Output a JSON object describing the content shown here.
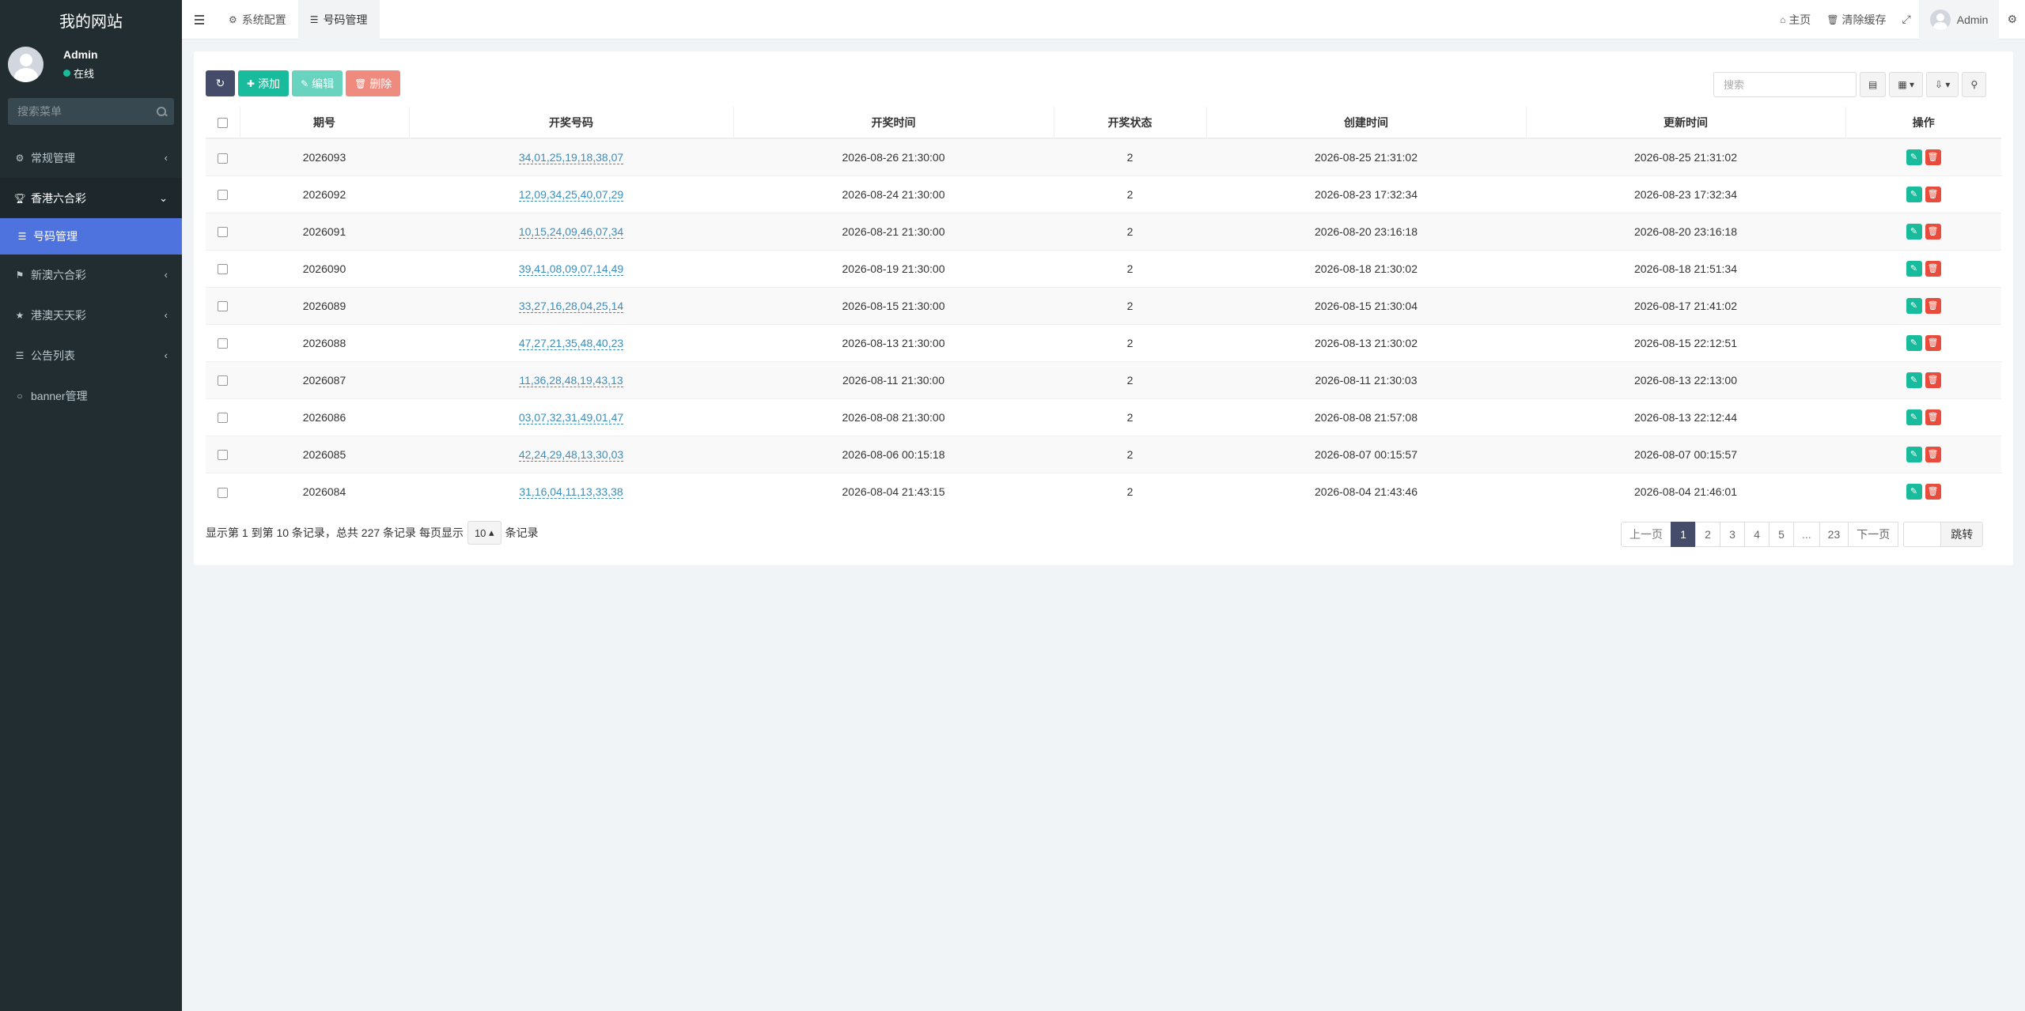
{
  "sidebar": {
    "logo": "我的网站",
    "user": {
      "name": "Admin",
      "status": "在线"
    },
    "search_placeholder": "搜索菜单",
    "items": [
      {
        "label": "常规管理",
        "icon": "cogs-icon"
      },
      {
        "label": "香港六合彩",
        "icon": "trophy-icon"
      },
      {
        "label": "号码管理",
        "icon": "list-icon"
      },
      {
        "label": "新澳六合彩",
        "icon": "flag-icon"
      },
      {
        "label": "港澳天天彩",
        "icon": "star-icon"
      },
      {
        "label": "公告列表",
        "icon": "list-icon"
      },
      {
        "label": "banner管理",
        "icon": "circle-icon"
      }
    ]
  },
  "header": {
    "tabs": [
      {
        "label": "系统配置"
      },
      {
        "label": "号码管理"
      }
    ],
    "right": {
      "home": "主页",
      "clear_cache": "清除缓存",
      "user": "Admin"
    }
  },
  "toolbar": {
    "add": "添加",
    "edit": "编辑",
    "delete": "删除",
    "search_placeholder": "搜索"
  },
  "table": {
    "columns": [
      "期号",
      "开奖号码",
      "开奖时间",
      "开奖状态",
      "创建时间",
      "更新时间",
      "操作"
    ],
    "rows": [
      {
        "issue": "2026093",
        "numbers": "34,01,25,19,18,38,07",
        "draw_time": "2026-08-26 21:30:00",
        "status": "2",
        "created": "2026-08-25 21:31:02",
        "updated": "2026-08-25 21:31:02"
      },
      {
        "issue": "2026092",
        "numbers": "12,09,34,25,40,07,29",
        "draw_time": "2026-08-24 21:30:00",
        "status": "2",
        "created": "2026-08-23 17:32:34",
        "updated": "2026-08-23 17:32:34"
      },
      {
        "issue": "2026091",
        "numbers": "10,15,24,09,46,07,34",
        "draw_time": "2026-08-21 21:30:00",
        "status": "2",
        "created": "2026-08-20 23:16:18",
        "updated": "2026-08-20 23:16:18"
      },
      {
        "issue": "2026090",
        "numbers": "39,41,08,09,07,14,49",
        "draw_time": "2026-08-19 21:30:00",
        "status": "2",
        "created": "2026-08-18 21:30:02",
        "updated": "2026-08-18 21:51:34"
      },
      {
        "issue": "2026089",
        "numbers": "33,27,16,28,04,25,14",
        "draw_time": "2026-08-15 21:30:00",
        "status": "2",
        "created": "2026-08-15 21:30:04",
        "updated": "2026-08-17 21:41:02"
      },
      {
        "issue": "2026088",
        "numbers": "47,27,21,35,48,40,23",
        "draw_time": "2026-08-13 21:30:00",
        "status": "2",
        "created": "2026-08-13 21:30:02",
        "updated": "2026-08-15 22:12:51"
      },
      {
        "issue": "2026087",
        "numbers": "11,36,28,48,19,43,13",
        "draw_time": "2026-08-11 21:30:00",
        "status": "2",
        "created": "2026-08-11 21:30:03",
        "updated": "2026-08-13 22:13:00"
      },
      {
        "issue": "2026086",
        "numbers": "03,07,32,31,49,01,47",
        "draw_time": "2026-08-08 21:30:00",
        "status": "2",
        "created": "2026-08-08 21:57:08",
        "updated": "2026-08-13 22:12:44"
      },
      {
        "issue": "2026085",
        "numbers": "42,24,29,48,13,30,03",
        "draw_time": "2026-08-06 00:15:18",
        "status": "2",
        "created": "2026-08-07 00:15:57",
        "updated": "2026-08-07 00:15:57"
      },
      {
        "issue": "2026084",
        "numbers": "31,16,04,11,13,33,38",
        "draw_time": "2026-08-04 21:43:15",
        "status": "2",
        "created": "2026-08-04 21:43:46",
        "updated": "2026-08-04 21:46:01"
      }
    ]
  },
  "footer": {
    "info_prefix": "显示第 1 到第 10 条记录，总共 227 条记录 每页显示",
    "page_size": "10",
    "info_suffix": "条记录"
  },
  "pagination": {
    "prev": "上一页",
    "pages": [
      "1",
      "2",
      "3",
      "4",
      "5",
      "...",
      "23"
    ],
    "current": "1",
    "next": "下一页",
    "jump": "跳转"
  },
  "colors": {
    "sidebar_bg": "#222d32",
    "active_menu": "#4e73df",
    "primary": "#18bc9c",
    "danger": "#e74c3c",
    "dark": "#444c69",
    "link": "#3c8dbc"
  }
}
